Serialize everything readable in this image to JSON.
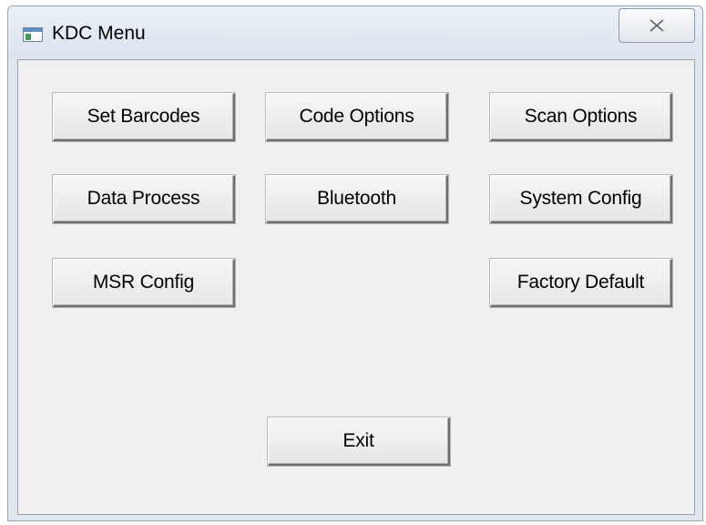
{
  "window": {
    "title": "KDC Menu",
    "title_icon": "window-app-icon",
    "close_icon": "close-x-icon"
  },
  "buttons": {
    "set_barcodes": "Set Barcodes",
    "code_options": "Code Options",
    "scan_options": "Scan Options",
    "data_process": "Data Process",
    "bluetooth": "Bluetooth",
    "system_config": "System Config",
    "msr_config": "MSR Config",
    "factory_default": "Factory Default",
    "exit": "Exit"
  },
  "colors": {
    "dialog_background": "#f0f0f0",
    "frame": "#dfe6ee"
  }
}
